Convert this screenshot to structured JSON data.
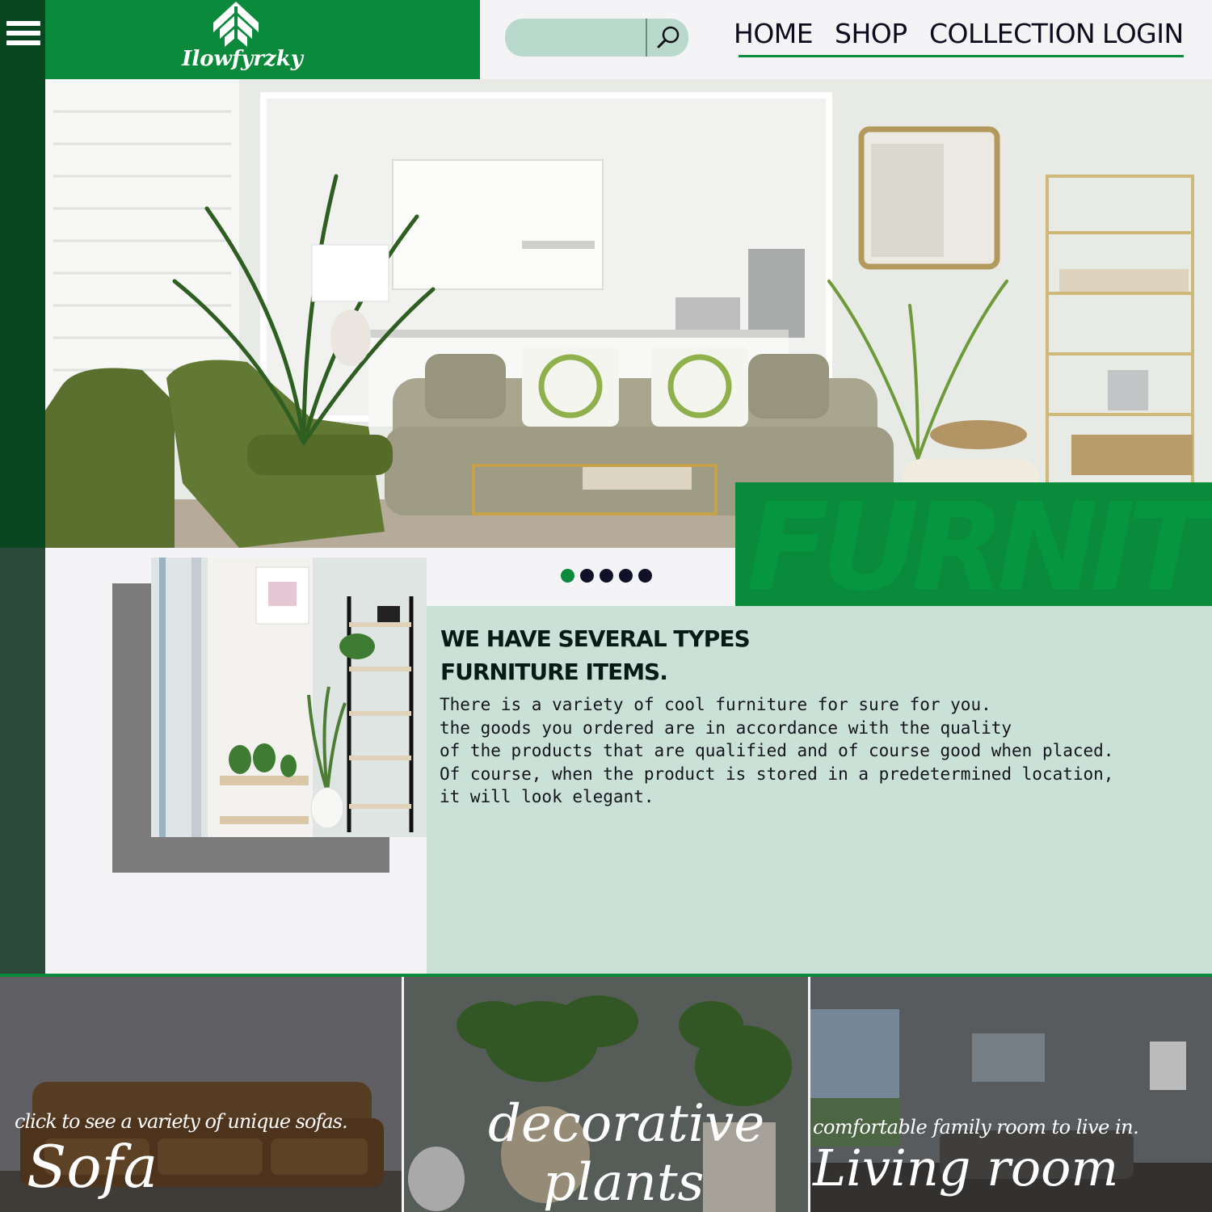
{
  "brand": {
    "name": "Ilowfyrzky"
  },
  "search": {
    "placeholder": ""
  },
  "nav": {
    "items": [
      "HOME",
      "SHOP",
      "COLLECTION",
      "LOGIN"
    ]
  },
  "hero": {
    "banner_text": "FURNIT"
  },
  "carousel": {
    "count": 5,
    "active": 0
  },
  "intro": {
    "headline_line1": "WE HAVE SEVERAL TYPES",
    "headline_line2": "FURNITURE ITEMS.",
    "body": "There is a variety of cool furniture for sure for you.\nthe goods you ordered are in accordance with the quality\nof the products that are qualified and of course good when placed.\nOf course, when the product is stored in a predetermined location,\nit will look elegant."
  },
  "categories": [
    {
      "subtitle": "click to see a variety of unique sofas.",
      "title": "Sofa"
    },
    {
      "title_line1": "decorative",
      "title_line2": "plants"
    },
    {
      "subtitle": "comfortable family room to live in.",
      "title": "Living room"
    }
  ],
  "colors": {
    "brand_green": "#0b8a3c",
    "dark_green": "#08461f",
    "mint": "#c9e1d7",
    "search_bg": "#b9d9cc"
  }
}
